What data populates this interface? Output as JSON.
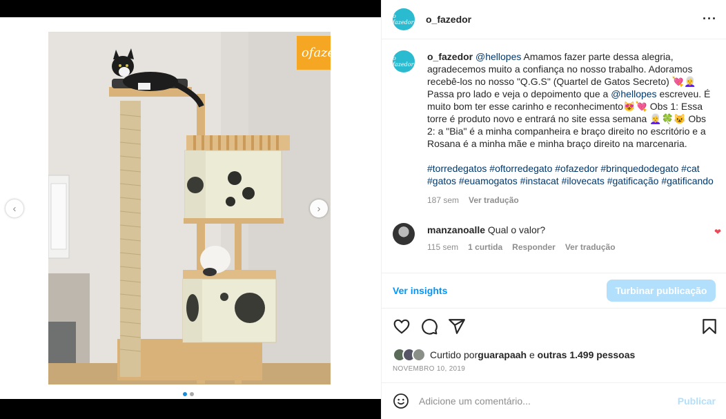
{
  "post": {
    "username": "o_fazedor",
    "avatar_text": "o fazedor",
    "watermark_text": "ofazedor"
  },
  "caption": {
    "username": "o_fazedor",
    "mention1": "@hellopes",
    "text1": " Amamos fazer parte dessa alegria, agradecemos muito a confiança no nosso trabalho. Adoramos recebê-los no nosso \"Q.G.S\" (Quartel de Gatos Secreto) 💘👩‍🦳 Passa pro lado e veja o depoimento que a ",
    "mention2": "@hellopes",
    "text2": " escreveu. É muito bom ter esse carinho e reconhecimento😻💘 Obs 1: Essa torre é produto novo e entrará no site essa semana 👩‍🦳🍀😺 Obs 2: a \"Bia\" é a minha companheira e braço direito no escritório e a Rosana é a minha mãe e minha braço direito na marcenaria.",
    "hashtags": "#torredegatos #oftorredegato #ofazedor #brinquedodegato #cat #gatos #euamogatos #instacat #ilovecats #gatificação #gatificando",
    "time": "187 sem",
    "see_translation": "Ver tradução"
  },
  "comment": {
    "username": "manzanoalle",
    "text": " Qual o valor?",
    "time": "115 sem",
    "likes": "1 curtida",
    "reply": "Responder",
    "see_translation": "Ver tradução"
  },
  "insights": {
    "link": "Ver insights",
    "boost": "Turbinar publicação"
  },
  "likes": {
    "prefix": "Curtido por ",
    "user": "guarapaah",
    "suffix": " e ",
    "others": "outras 1.499 pessoas"
  },
  "date": "NOVEMBRO 10, 2019",
  "add_comment": {
    "placeholder": "Adicione um comentário...",
    "publish": "Publicar"
  },
  "carousel": {
    "slide": 1,
    "total": 2
  },
  "colors": {
    "accent": "#0095f6",
    "accent_disabled": "#b2dffc",
    "heart": "#ed4956",
    "avatar_bg": "#2bbbd0",
    "watermark_bg": "#f5a623"
  }
}
